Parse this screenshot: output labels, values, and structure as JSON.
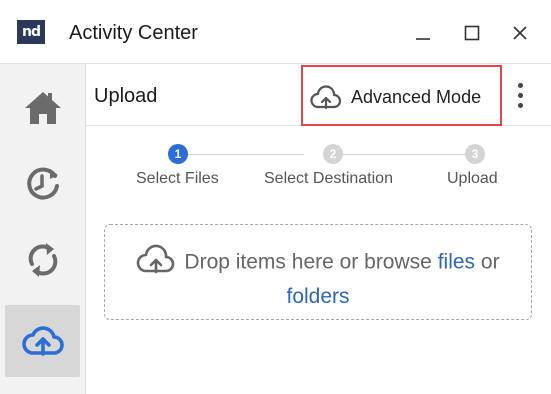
{
  "window": {
    "logo_text": "nd",
    "title": "Activity Center"
  },
  "sidebar": {
    "items": [
      {
        "name": "home",
        "icon": "home-icon",
        "active": false
      },
      {
        "name": "history",
        "icon": "history-icon",
        "active": false
      },
      {
        "name": "sync",
        "icon": "sync-icon",
        "active": false
      },
      {
        "name": "upload",
        "icon": "cloud-upload-icon",
        "active": true
      }
    ]
  },
  "header": {
    "title": "Upload",
    "advanced_mode_label": "Advanced Mode"
  },
  "stepper": {
    "steps": [
      {
        "number": "1",
        "label": "Select Files",
        "active": true
      },
      {
        "number": "2",
        "label": "Select Destination",
        "active": false
      },
      {
        "number": "3",
        "label": "Upload",
        "active": false
      }
    ]
  },
  "dropzone": {
    "text_before": "Drop items here or browse",
    "files_link": "files",
    "connector": "or",
    "folders_link": "folders"
  },
  "colors": {
    "accent": "#2b6fd6",
    "link": "#2e67b8",
    "highlight_border": "#e0454a",
    "sidebar_bg": "#f2f2f2",
    "sidebar_active_bg": "#d7d7d7",
    "step_inactive": "#d4d4d4"
  }
}
